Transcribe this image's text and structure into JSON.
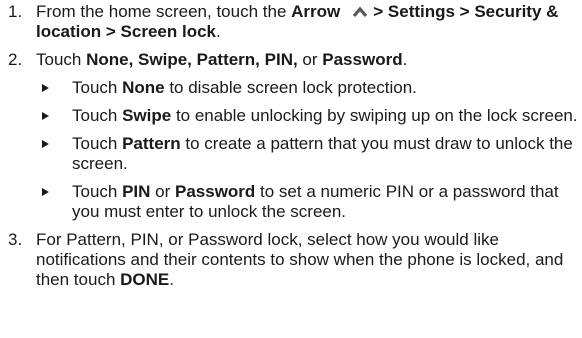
{
  "steps": [
    {
      "number": "1.",
      "text_a": "From the home screen, touch the ",
      "b_arrow": "Arrow",
      "arrow_icon": "chevron-up-icon",
      "b_path": "> Settings > Security & location > Screen lock",
      "text_b": "."
    },
    {
      "number": "2.",
      "text_a": "Touch ",
      "b_options": "None, Swipe, Pattern, PIN,",
      "text_or": " or ",
      "b_password": "Password",
      "text_end": ".",
      "subitems": [
        {
          "pre": "Touch ",
          "bold": "None",
          "post": " to disable screen lock protection."
        },
        {
          "pre": "Touch ",
          "bold": "Swipe",
          "post": " to enable unlocking by swiping up on the lock screen."
        },
        {
          "pre": "Touch ",
          "bold": "Pattern",
          "post": " to create a pattern that you must draw to unlock the screen."
        },
        {
          "pre": "Touch ",
          "bold": "PIN",
          "mid": " or ",
          "bold2": "Password",
          "post": " to set a numeric PIN or a password that you must enter to unlock the screen."
        }
      ]
    },
    {
      "number": "3.",
      "text_a": "For Pattern, PIN, or Password lock, select how you would like notifications and their contents to show when the phone is locked, and then touch ",
      "b_done": "DONE",
      "text_end": "."
    }
  ]
}
